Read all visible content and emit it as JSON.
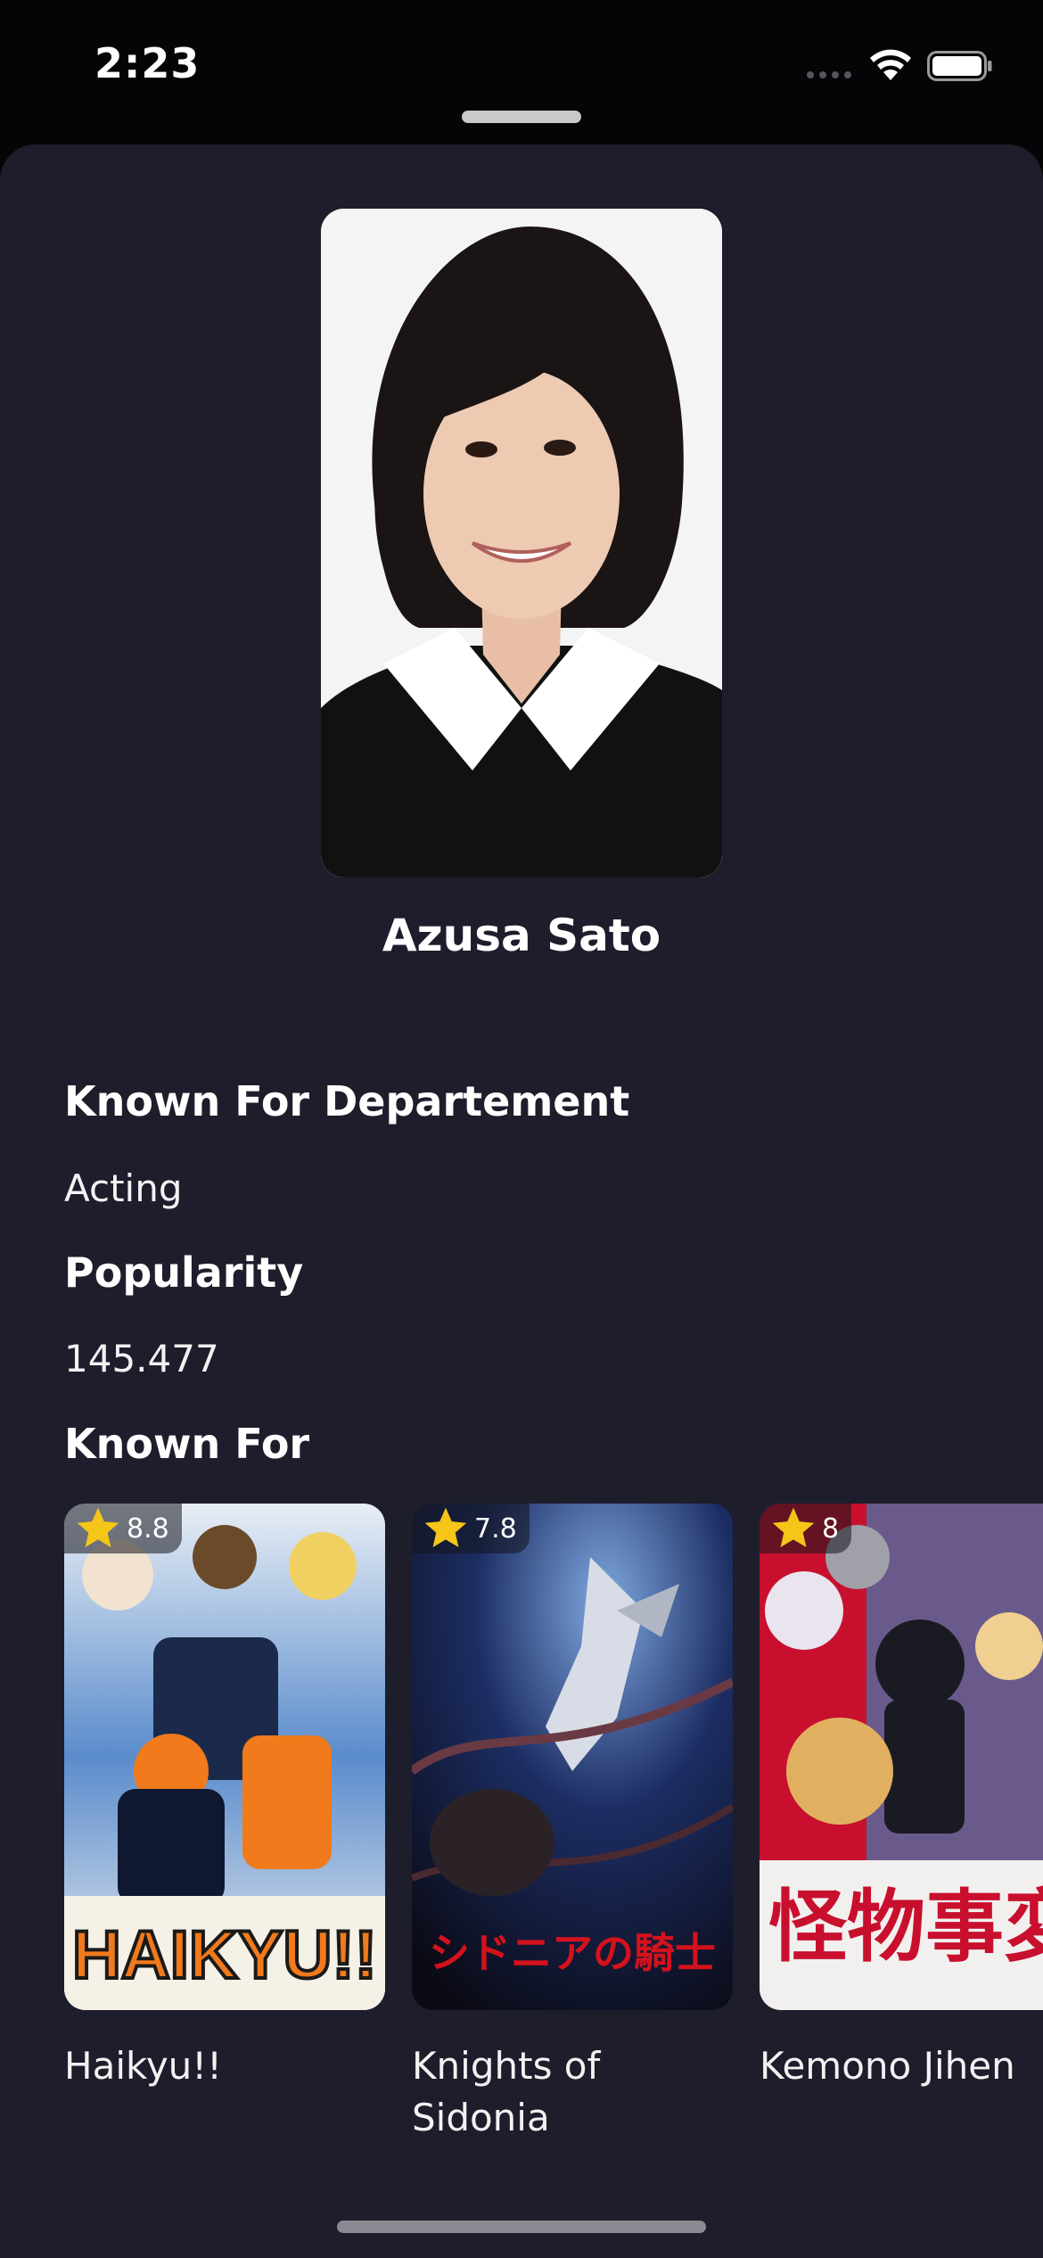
{
  "status_bar": {
    "time": "2:23"
  },
  "person": {
    "name": "Azusa Sato",
    "photo_icon": "portrait-photo"
  },
  "sections": {
    "department_heading": "Known For Departement",
    "department_value": "Acting",
    "popularity_heading": "Popularity",
    "popularity_value": "145.477",
    "known_for_heading": "Known For"
  },
  "known_for": [
    {
      "title": "Haikyu!!",
      "rating": "8.8",
      "poster_text": "HAIKYU!!",
      "accent": "#f07a1c"
    },
    {
      "title": "Knights of Sidonia",
      "rating": "7.8",
      "poster_text": "シドニアの騎士",
      "accent": "#d4121c"
    },
    {
      "title": "Kemono Jihen",
      "rating": "8",
      "poster_text": "怪物事変",
      "accent": "#c8102e"
    }
  ],
  "colors": {
    "background": "#050508",
    "sheet": "#1e1d2c",
    "star": "#f5c518"
  }
}
